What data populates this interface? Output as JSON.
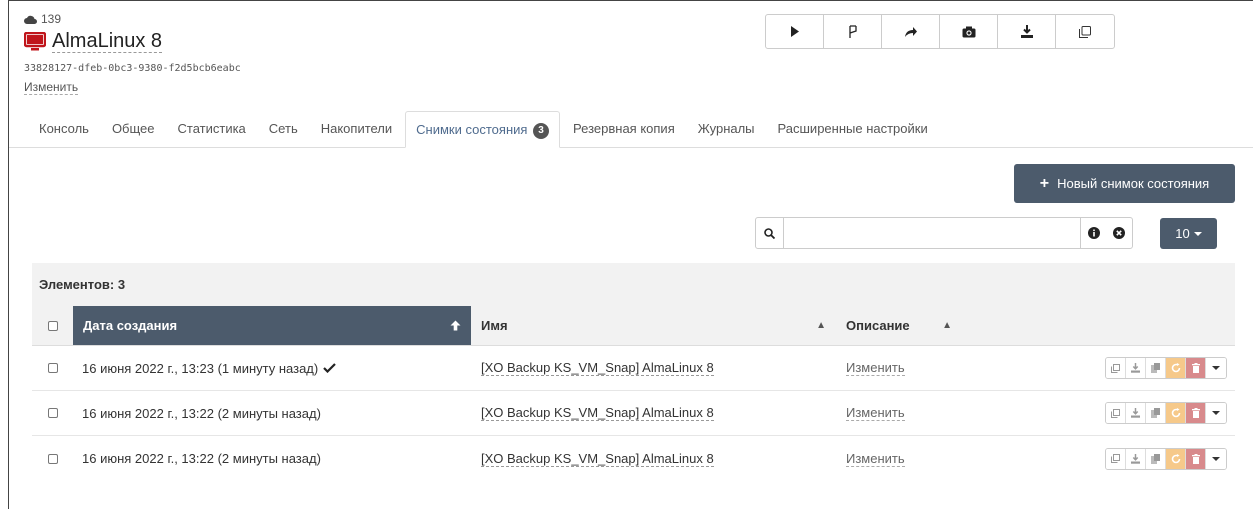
{
  "header": {
    "pool_count": "139",
    "vm_name": "AlmaLinux 8",
    "uuid": "33828127-dfeb-0bc3-9380-f2d5bcb6eabc",
    "edit_label": "Изменить"
  },
  "toolbar": {
    "buttons": [
      "play-icon",
      "fast-clone-icon",
      "migrate-icon",
      "snapshot-icon",
      "export-icon",
      "copy-icon"
    ]
  },
  "tabs": [
    {
      "label": "Консоль"
    },
    {
      "label": "Общее"
    },
    {
      "label": "Статистика"
    },
    {
      "label": "Сеть"
    },
    {
      "label": "Накопители"
    },
    {
      "label": "Снимки состояния",
      "badge": "3",
      "active": true
    },
    {
      "label": "Резервная копия"
    },
    {
      "label": "Журналы"
    },
    {
      "label": "Расширенные настройки"
    }
  ],
  "new_snapshot_label": "Новый снимок состояния",
  "search": {
    "value": "",
    "placeholder": ""
  },
  "page_size": "10",
  "table": {
    "count_label": "Элементов: 3",
    "columns": {
      "date": "Дата создания",
      "name": "Имя",
      "description": "Описание"
    },
    "rows": [
      {
        "date": "16 июня 2022 г., 13:23 (1 минуту назад)",
        "current": true,
        "name": "[XO Backup KS_VM_Snap] AlmaLinux 8",
        "description": "Изменить"
      },
      {
        "date": "16 июня 2022 г., 13:22 (2 минуты назад)",
        "current": false,
        "name": "[XO Backup KS_VM_Snap] AlmaLinux 8",
        "description": "Изменить"
      },
      {
        "date": "16 июня 2022 г., 13:22 (2 минуты назад)",
        "current": false,
        "name": "[XO Backup KS_VM_Snap] AlmaLinux 8",
        "description": "Изменить"
      }
    ]
  },
  "colors": {
    "accent": "#4c5b6c",
    "vm_icon": "#c0151b",
    "tab_active": "#4f6b8e",
    "warning": "#f6c98a",
    "danger": "#d88a8c"
  }
}
